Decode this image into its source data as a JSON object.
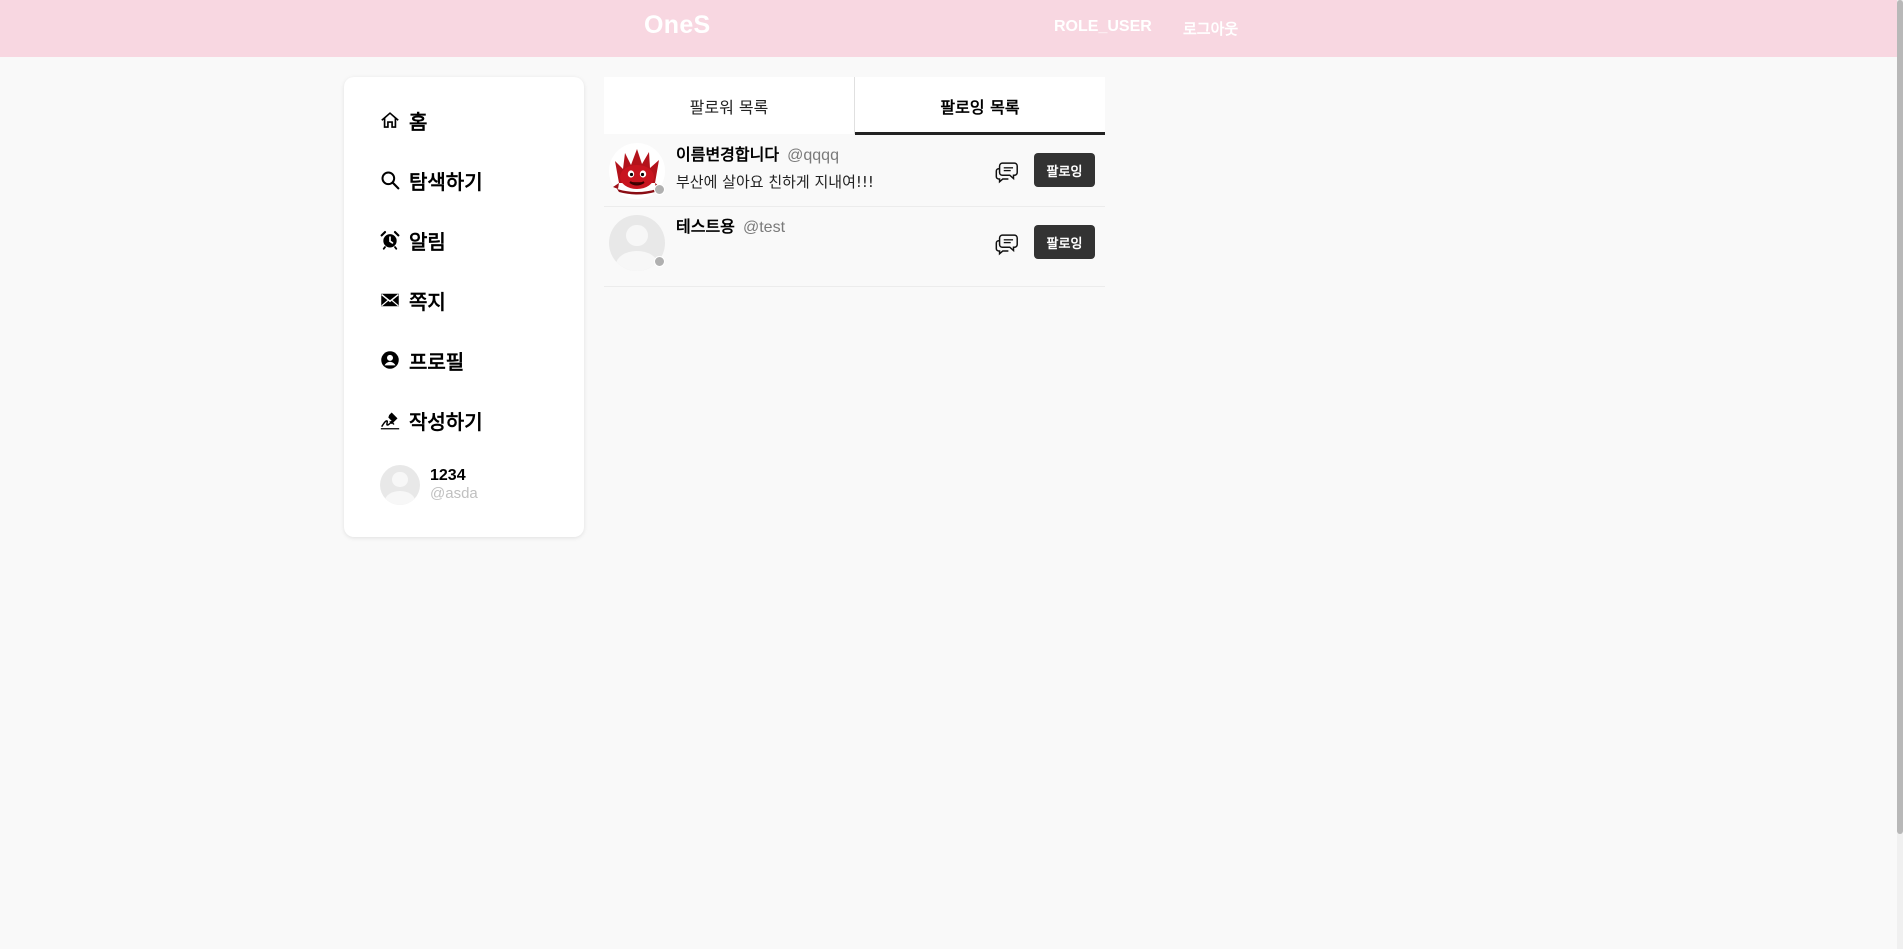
{
  "header": {
    "brand": "OneS",
    "role": "ROLE_USER",
    "logout": "로그아웃",
    "background_color": "#f8d7e1"
  },
  "sidebar": {
    "items": [
      {
        "label": "홈",
        "icon": "home-icon"
      },
      {
        "label": "탐색하기",
        "icon": "search-icon"
      },
      {
        "label": "알림",
        "icon": "alarm-clock-icon"
      },
      {
        "label": "쪽지",
        "icon": "envelope-icon"
      },
      {
        "label": "프로필",
        "icon": "user-circle-icon"
      },
      {
        "label": "작성하기",
        "icon": "signature-icon"
      }
    ],
    "user": {
      "name": "1234",
      "handle": "@asda"
    }
  },
  "tabs": [
    {
      "label": "팔로워 목록",
      "active": false
    },
    {
      "label": "팔로잉 목록",
      "active": true
    }
  ],
  "following": [
    {
      "name": "이름변경합니다",
      "handle": "@qqqq",
      "bio": "부산에 살아요 친하게 지내여!!!",
      "avatar": "red-character-avatar",
      "button": "팔로잉"
    },
    {
      "name": "테스트용",
      "handle": "@test",
      "bio": "",
      "avatar": "default-avatar",
      "button": "팔로잉"
    }
  ],
  "colors": {
    "accent_dark": "#333333",
    "page_background": "#f9f9f9"
  }
}
